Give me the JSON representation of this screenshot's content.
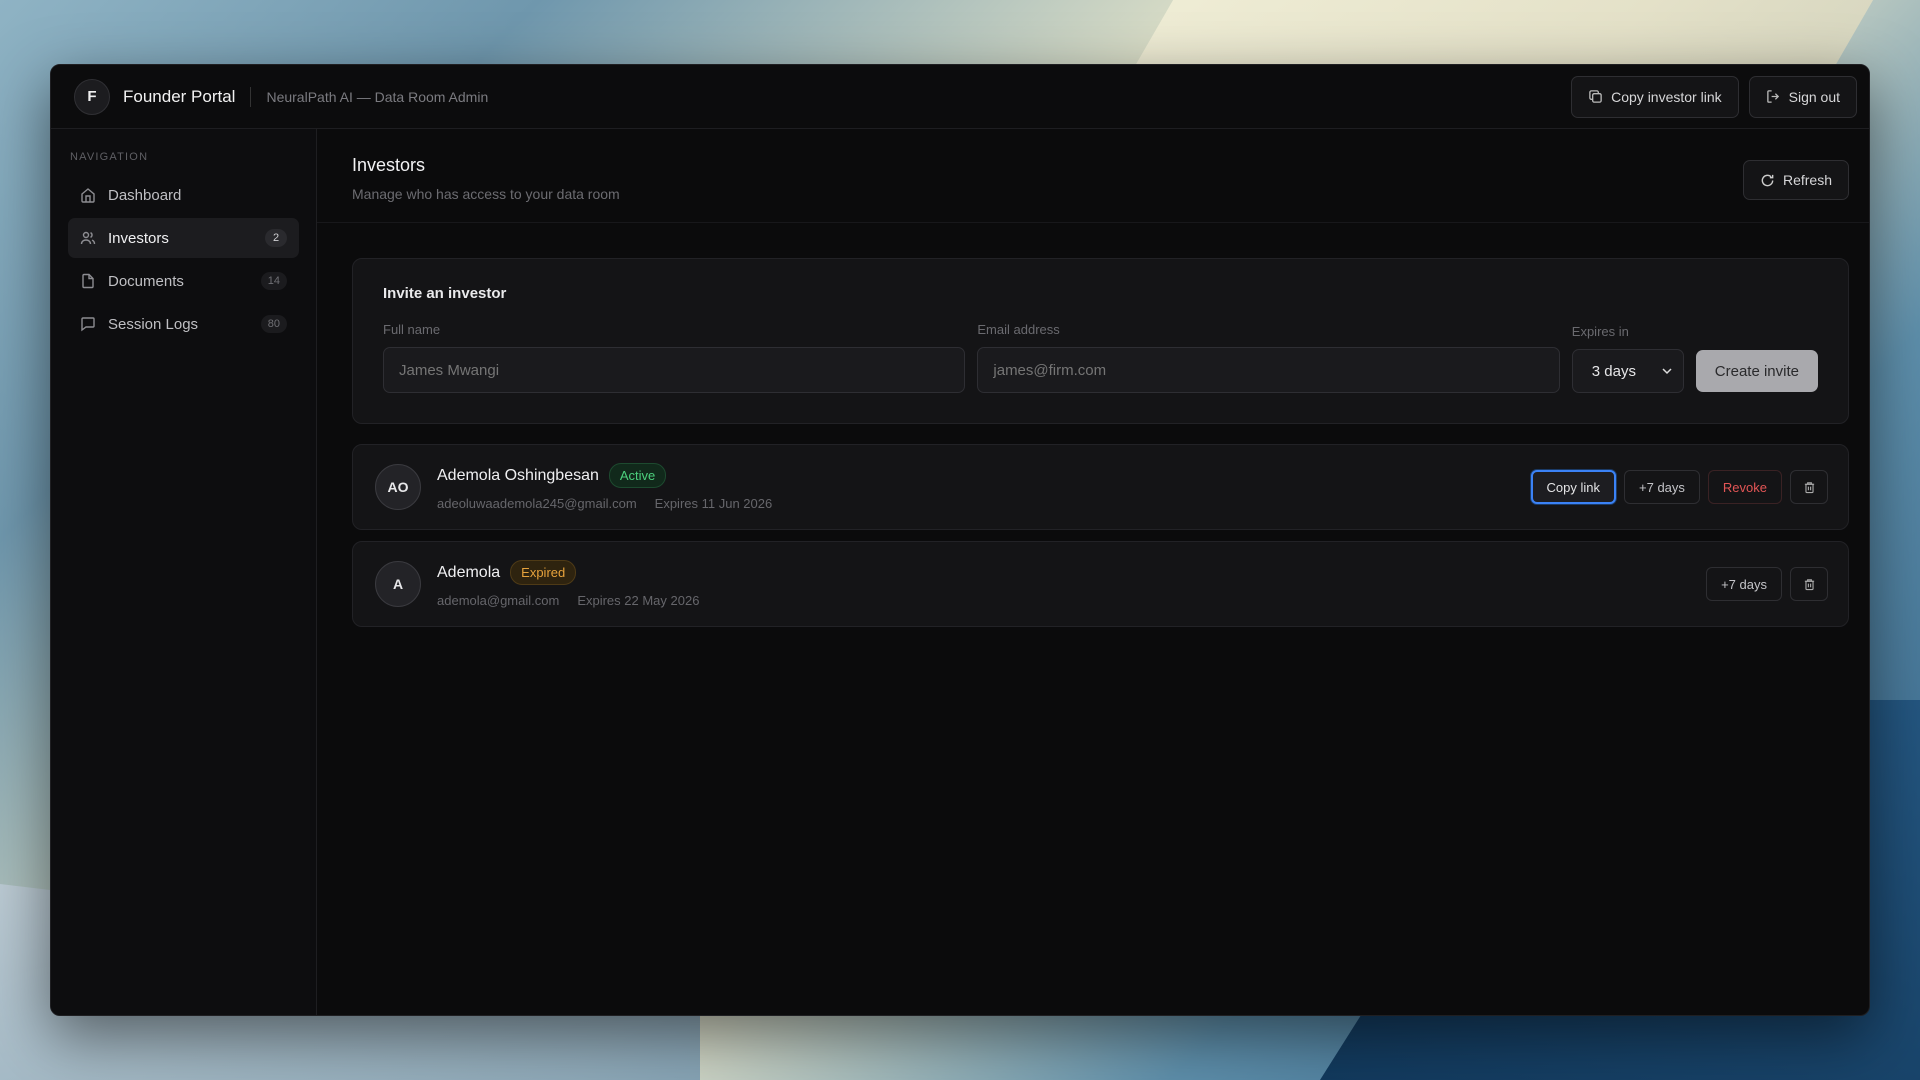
{
  "app": {
    "logo_letter": "F",
    "title": "Founder Portal",
    "subtitle": "NeuralPath AI — Data Room Admin"
  },
  "topbar": {
    "copy_link_label": "Copy investor link",
    "sign_out_label": "Sign out"
  },
  "sidebar": {
    "heading": "NAVIGATION",
    "items": [
      {
        "label": "Dashboard",
        "icon": "home-icon",
        "count": ""
      },
      {
        "label": "Investors",
        "icon": "users-icon",
        "count": "2"
      },
      {
        "label": "Documents",
        "icon": "file-icon",
        "count": "14"
      },
      {
        "label": "Session Logs",
        "icon": "message-icon",
        "count": "80"
      }
    ]
  },
  "page": {
    "title": "Investors",
    "description": "Manage who has access to your data room",
    "refresh_label": "Refresh"
  },
  "invite": {
    "title": "Invite an investor",
    "name_label": "Full name",
    "name_placeholder": "James Mwangi",
    "email_label": "Email address",
    "email_placeholder": "james@firm.com",
    "expires_label": "Expires in",
    "expires_value": "3 days",
    "create_label": "Create invite"
  },
  "investors": [
    {
      "initials": "AO",
      "name": "Ademola Oshingbesan",
      "status": "Active",
      "email": "adeoluwaademola245@gmail.com",
      "expires": "Expires 11 Jun 2026",
      "copy_label": "Copy link",
      "extend_label": "+7 days",
      "revoke_label": "Revoke"
    },
    {
      "initials": "A",
      "name": "Ademola",
      "status": "Expired",
      "email": "ademola@gmail.com",
      "expires": "Expires 22 May 2026",
      "extend_label": "+7 days"
    }
  ]
}
